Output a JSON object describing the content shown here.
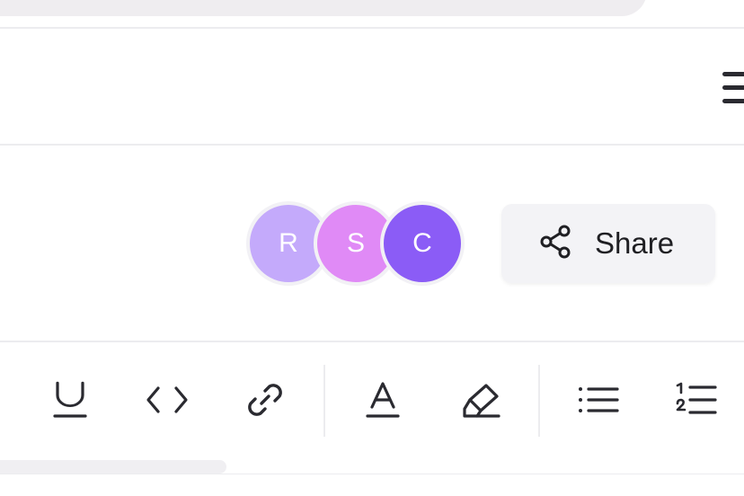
{
  "collaborators": [
    {
      "initial": "R",
      "color": "#c4aafb"
    },
    {
      "initial": "S",
      "color": "#e08af6"
    },
    {
      "initial": "C",
      "color": "#8b5cf6"
    }
  ],
  "share": {
    "label": "Share",
    "icon": "share-icon"
  },
  "toolbar": {
    "icons": [
      "underline-icon",
      "code-icon",
      "link-icon",
      "text-color-icon",
      "highlighter-icon",
      "bullet-list-icon",
      "numbered-list-icon"
    ]
  },
  "header": {
    "menu_icon": "menu-icon"
  },
  "colors": {
    "icon": "#2a2a30",
    "divider": "#ececef",
    "button_bg": "#f3f3f6"
  }
}
